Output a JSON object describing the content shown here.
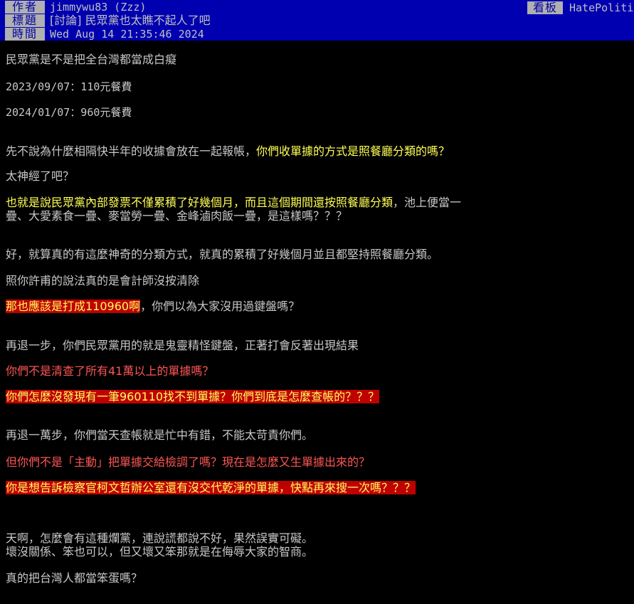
{
  "header": {
    "author_label": "作者",
    "author_value": "jimmywu83 (Zzz)",
    "board_label": "看板",
    "board_value": "HatePoliti",
    "title_label": "標題",
    "title_value": "[討論] 民眾黨也太瞧不起人了吧",
    "time_label": "時間",
    "time_value": "Wed Aug 14 21:35:46 2024"
  },
  "body": {
    "l1": "民眾黨是不是把全台灣都當成白癡",
    "l2": "2023/09/07：110元餐費",
    "l3": "2024/01/07：960元餐費",
    "l4a": "先不說為什麼相隔快半年的收據會放在一起報帳，",
    "l4b": "你們收單據的方式是照餐廳分類的嗎？",
    "l5": "太神經了吧？",
    "l6a": "也就是說民眾黨內部發票不僅累積了好幾個月，而且這個期間還按照餐廳分類",
    "l6b": "，池上便當一",
    "l7": "疊、大愛素食一疊、麥當勞一疊、金峰滷肉飯一疊，是這樣嗎？？？",
    "l8": "好，就算真的有這麼神奇的分類方式，就真的累積了好幾個月並且都堅持照餐廳分類。",
    "l9": "照你許甫的說法真的是會計師沒按清除",
    "l10a": "那也應該是打成110960啊",
    "l10b": "，你們以為大家沒用過鍵盤嗎？",
    "l11": "再退一步，你們民眾黨用的就是鬼靈精怪鍵盤，正著打會反著出現結果",
    "l12": "你們不是清查了所有41萬以上的單據嗎？",
    "l13": "你們怎麼沒發現有一筆960110找不到單據？你們到底是怎麼查帳的？？？",
    "l14": "再退一萬步，你們當天查帳就是忙中有錯，不能太苛責你們。",
    "l15": "但你們不是「主動」把單據交給檢調了嗎？現在是怎麼又生單據出來的？",
    "l16": "你是想告訴檢察官柯文哲辦公室還有沒交代乾淨的單據，快點再來搜一次嗎？？？",
    "l17": "天啊，怎麼會有這種爛黨，連說謊都說不好，果然誤實可礙。",
    "l18": "壞沒關係、笨也可以，但又壞又笨那就是在侮辱大家的智商。",
    "l19": "真的把台灣人都當笨蛋嗎？"
  }
}
